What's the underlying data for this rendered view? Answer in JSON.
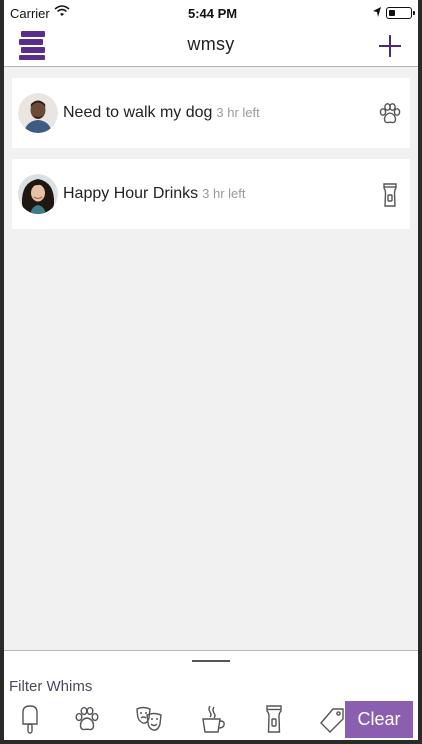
{
  "status_bar": {
    "carrier": "Carrier",
    "time": "5:44 PM"
  },
  "nav": {
    "title": "wmsy",
    "menu_icon": "stacked-bars-menu-icon",
    "add_icon": "plus-icon"
  },
  "whims": [
    {
      "title": "Need to walk my dog",
      "time_left": "3 hr left",
      "icon": "paw-icon"
    },
    {
      "title": "Happy Hour Drinks",
      "time_left": "3 hr left",
      "icon": "pint-glass-icon"
    }
  ],
  "filter": {
    "label": "Filter Whims",
    "icons": [
      "popsicle-icon",
      "paw-icon",
      "theater-masks-icon",
      "coffee-cup-icon",
      "pint-glass-icon",
      "tag-icon"
    ],
    "clear_label": "Clear"
  },
  "colors": {
    "brand_purple": "#5b2e8c",
    "clear_button": "#8b5fb0",
    "background": "#f1f1f1"
  }
}
